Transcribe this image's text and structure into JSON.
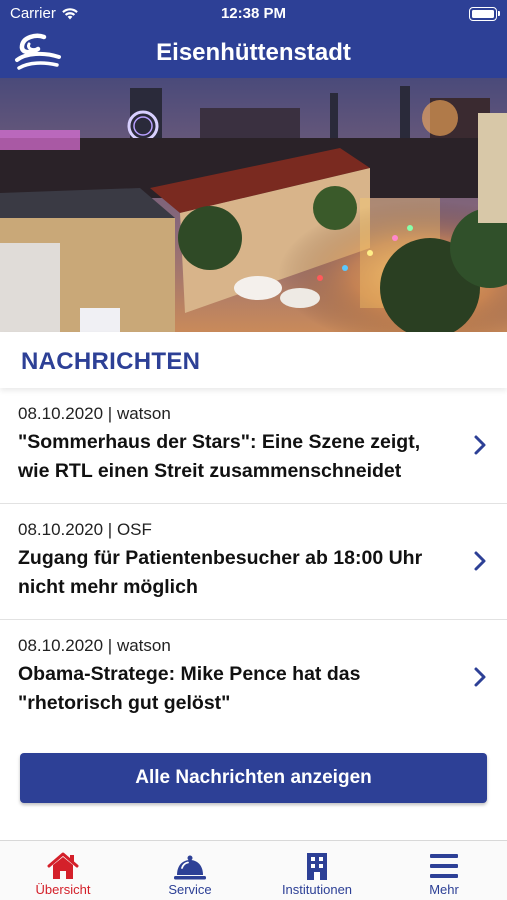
{
  "status_bar": {
    "carrier": "Carrier",
    "time": "12:38 PM"
  },
  "header": {
    "title": "Eisenhüttenstadt",
    "logo_icon": "city-logo-icon"
  },
  "section": {
    "title": "NACHRICHTEN"
  },
  "news": [
    {
      "date": "08.10.2020",
      "source": "watson",
      "meta": "08.10.2020 | watson",
      "headline": "\"Sommerhaus der Stars\": Eine Szene zeigt, wie RTL einen Streit zusammenschneidet"
    },
    {
      "date": "08.10.2020",
      "source": "OSF",
      "meta": "08.10.2020 | OSF",
      "headline": "Zugang für Patientenbesucher ab 18:00 Uhr nicht mehr möglich"
    },
    {
      "date": "08.10.2020",
      "source": "watson",
      "meta": "08.10.2020 | watson",
      "headline": "Obama-Stratege: Mike Pence hat das \"rhetorisch gut gelöst\""
    }
  ],
  "all_news_button": "Alle Nachrichten anzeigen",
  "tabs": [
    {
      "label": "Übersicht",
      "icon": "home-icon",
      "active": true
    },
    {
      "label": "Service",
      "icon": "service-bell-icon",
      "active": false
    },
    {
      "label": "Institutionen",
      "icon": "building-icon",
      "active": false
    },
    {
      "label": "Mehr",
      "icon": "menu-icon",
      "active": false
    }
  ],
  "colors": {
    "brand": "#2d4096",
    "active_tab": "#d4202a"
  }
}
